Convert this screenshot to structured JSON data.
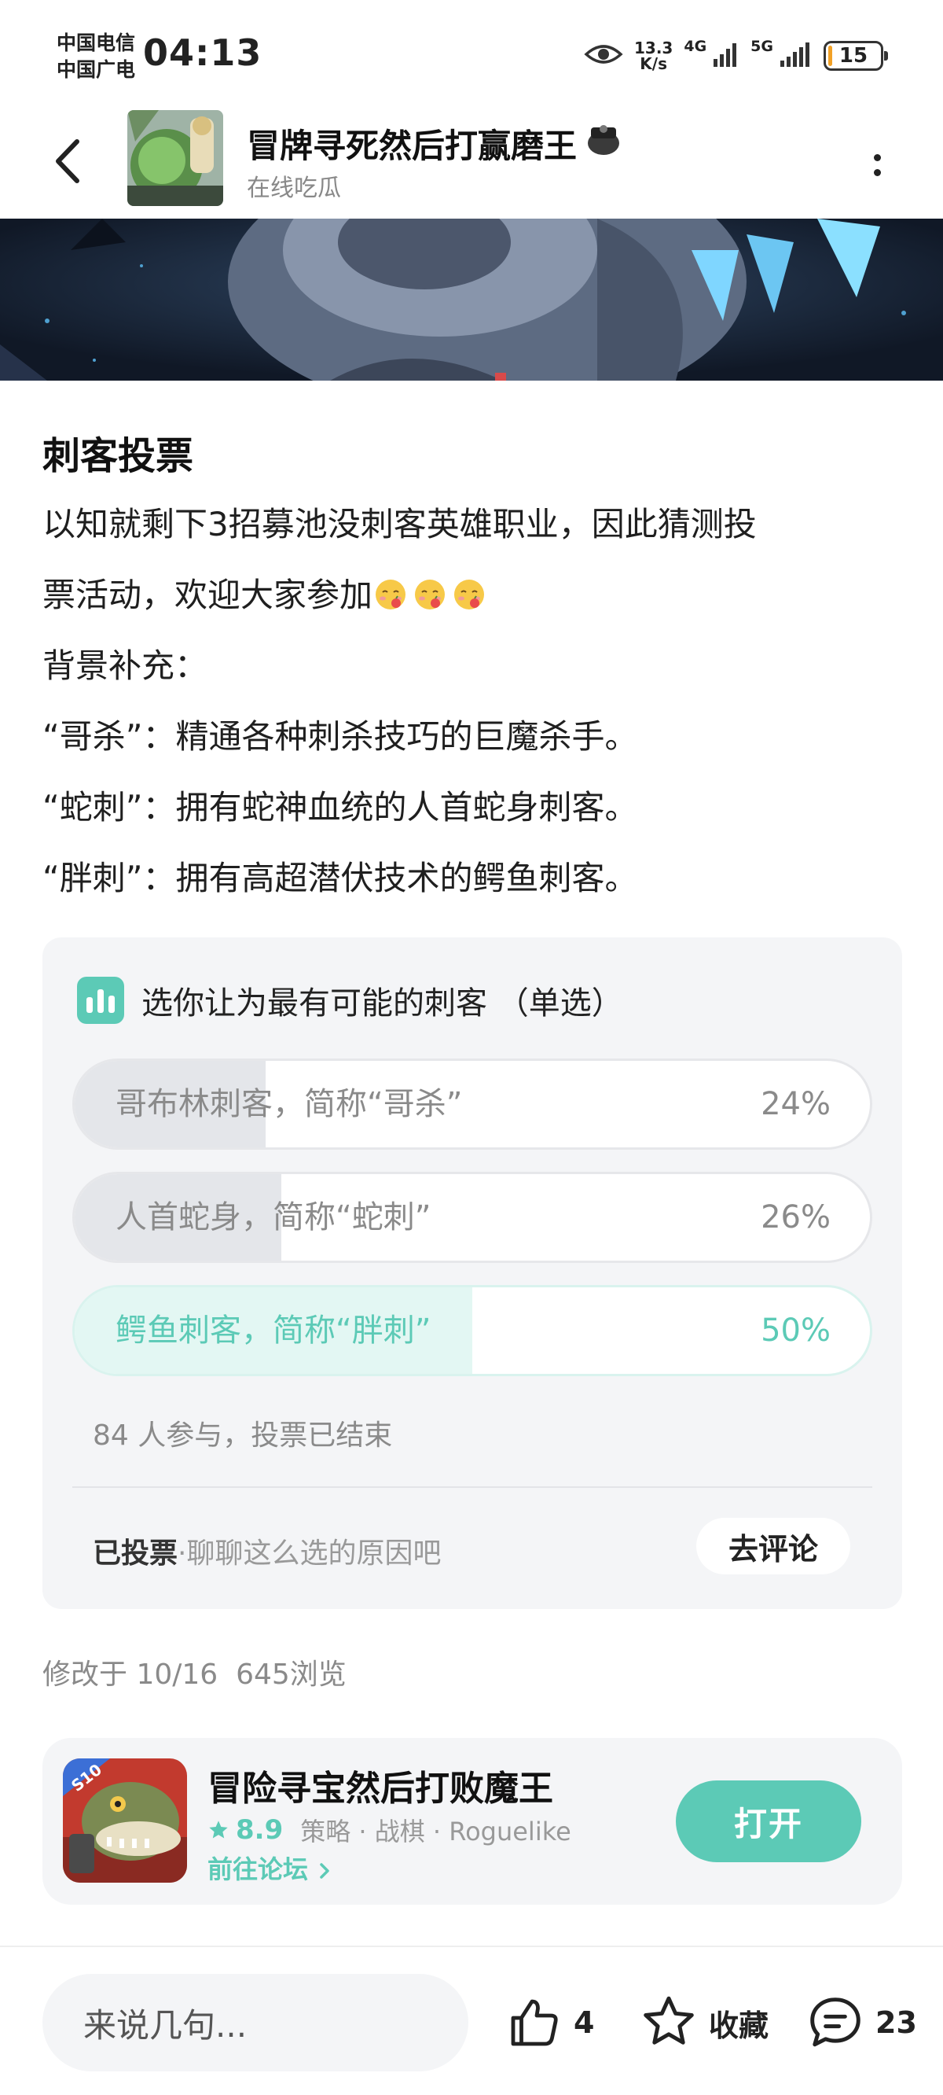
{
  "status_bar": {
    "carrier_1": "中国电信",
    "carrier_2": "中国广电",
    "time": "04:13",
    "net_speed_value": "13.3",
    "net_speed_unit": "K/s",
    "signal_1": "4G",
    "signal_2": "5G",
    "battery": "15",
    "battery_fraction": 0.15
  },
  "header": {
    "forum_title": "冒牌寻死然后打赢磨王",
    "forum_subtitle": "在线吃瓜"
  },
  "post": {
    "title": "刺客投票",
    "lines": [
      "以知就剩下3招募池没刺客英雄职业，因此猜测投",
      "票活动，欢迎大家参加",
      "背景补充：",
      "“哥杀”：精通各种刺杀技巧的巨魔杀手。",
      "“蛇刺”：拥有蛇神血统的人首蛇身刺客。",
      "“胖刺”：拥有高超潜伏技术的鳄鱼刺客。"
    ]
  },
  "vote": {
    "question": "选你让为最有可能的刺客  （单选）",
    "options": [
      {
        "label": "哥布林刺客，简称“哥杀”",
        "percent": "24%",
        "fraction": 0.24,
        "selected": false
      },
      {
        "label": "人首蛇身，简称“蛇刺”",
        "percent": "26%",
        "fraction": 0.26,
        "selected": false
      },
      {
        "label": "鳄鱼刺客，简称“胖刺”",
        "percent": "50%",
        "fraction": 0.5,
        "selected": true
      }
    ],
    "status": "84 人参与，投票已结束",
    "voted_label": "已投票",
    "voted_hint": "·聊聊这么选的原因吧",
    "comment_button": "去评论"
  },
  "meta": {
    "edited": "修改于 10/16",
    "views": "645浏览"
  },
  "app_promo": {
    "name": "冒险寻宝然后打败魔王",
    "rating": "8.9",
    "tags": "策略 · 战棋 · Roguelike",
    "forum_link": "前往论坛",
    "open_button": "打开",
    "icon_badge": "S10"
  },
  "bottom_bar": {
    "comment_placeholder": "来说几句...",
    "like_count": "4",
    "favorite_label": "收藏",
    "comment_count": "23"
  },
  "colors": {
    "accent": "#5ccab6",
    "card_bg": "#f4f5f7",
    "muted_text": "#8a8a8a",
    "battery": "#f2a126"
  },
  "icons": [
    "eye-icon",
    "signal-icon",
    "battery-icon",
    "back-icon",
    "more-icon",
    "vote-chart-icon",
    "star-icon",
    "chevron-right-icon",
    "thumbs-up-icon",
    "favorite-star-icon",
    "comment-bubble-icon",
    "emoji-icon"
  ]
}
